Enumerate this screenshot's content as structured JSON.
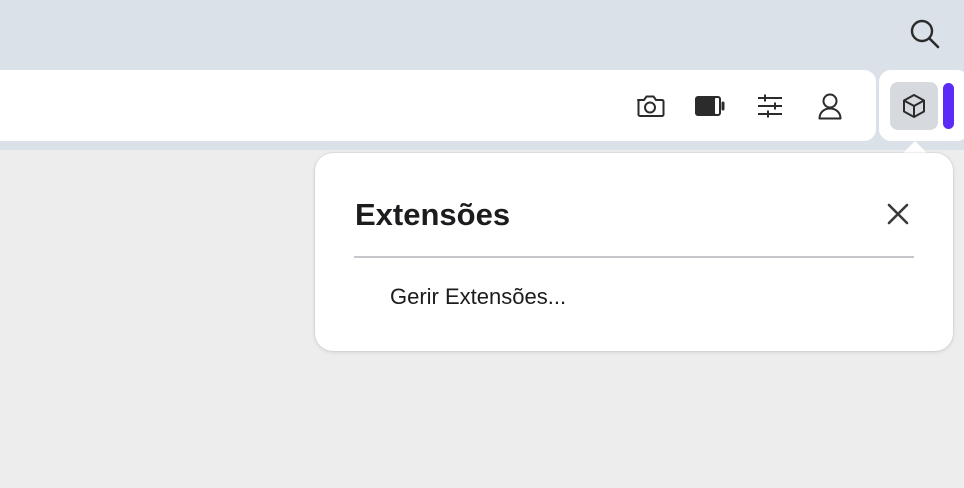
{
  "toolbar": {
    "search_icon": "search-icon",
    "buttons": [
      {
        "name": "camera",
        "icon": "camera-icon"
      },
      {
        "name": "battery",
        "icon": "battery-icon"
      },
      {
        "name": "settings",
        "icon": "sliders-icon"
      },
      {
        "name": "profile",
        "icon": "user-icon"
      }
    ],
    "extensions_icon": "cube-icon",
    "accent_color": "#5b2cf5"
  },
  "extensions_popup": {
    "title": "Extensões",
    "close_icon": "close-icon",
    "manage_label": "Gerir Extensões..."
  },
  "colors": {
    "topbar": "#dbe1e8",
    "background": "#ededed",
    "popup": "#ffffff",
    "text": "#1c1c1e"
  }
}
